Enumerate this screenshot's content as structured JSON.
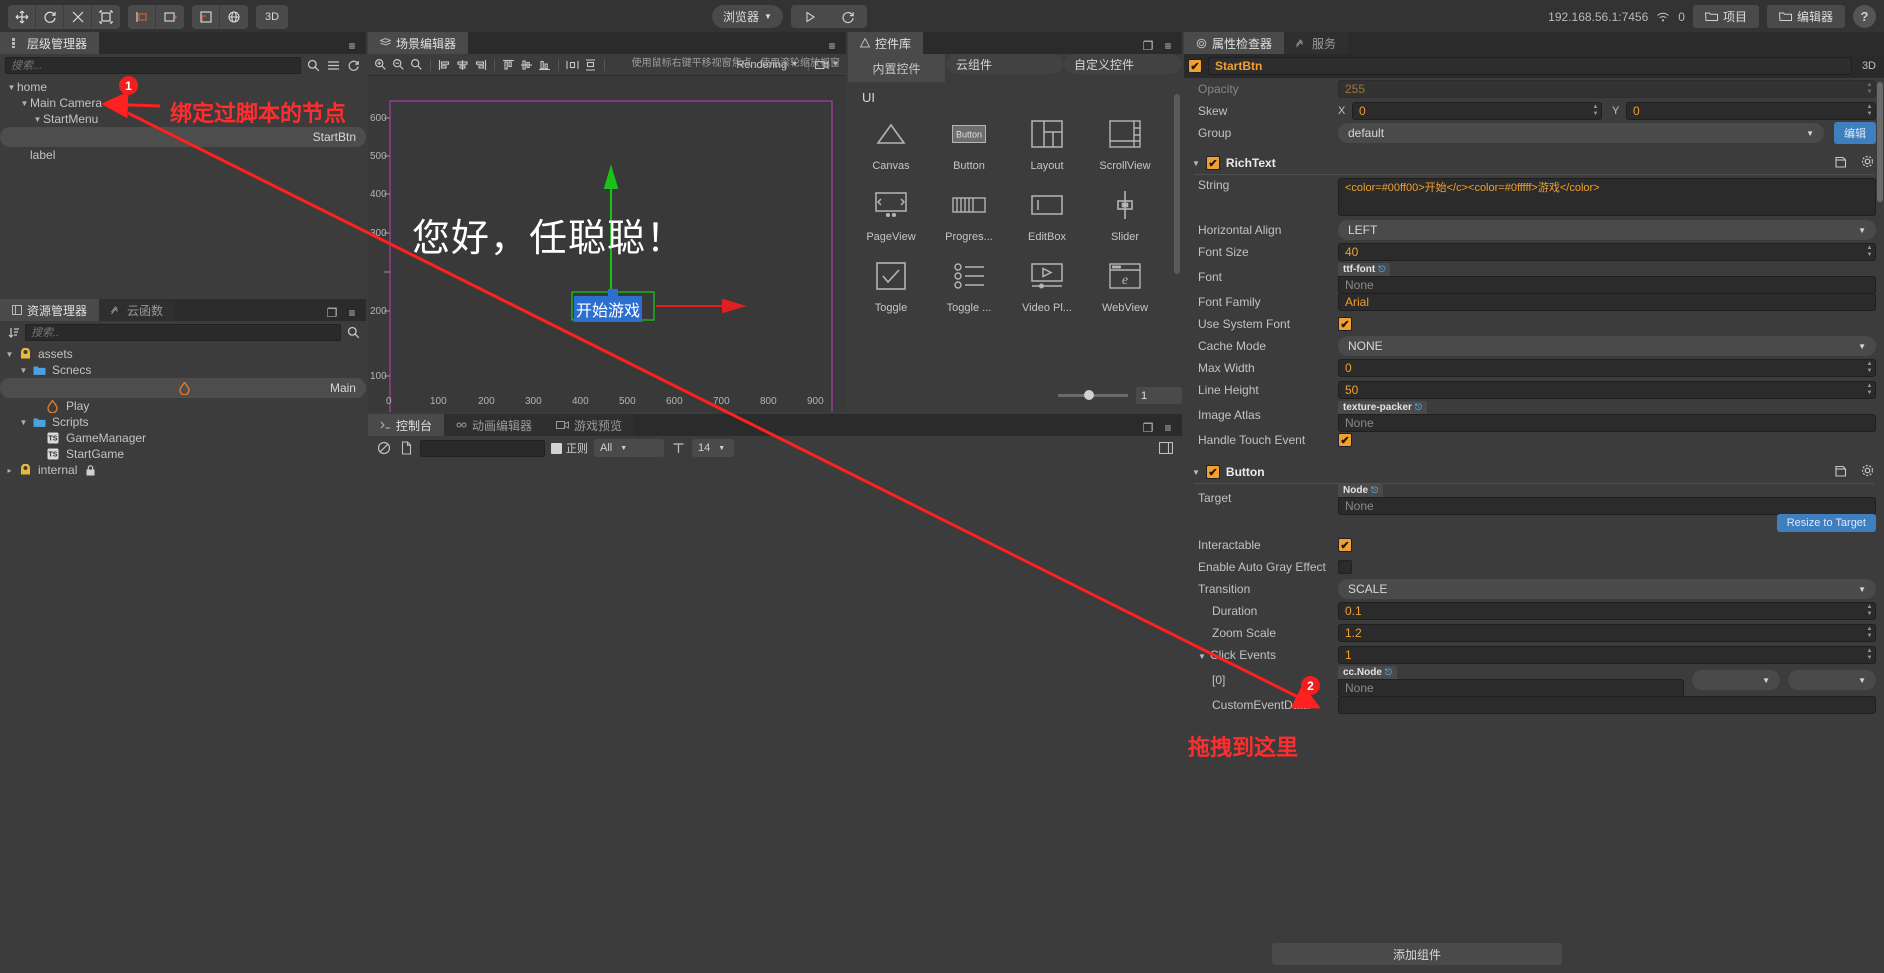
{
  "toolbar": {
    "tools": [
      "move-tool",
      "rotate-tool",
      "scale-tool",
      "rect-tool",
      "align-tool",
      "add-tool",
      "anchor-tool",
      "pivot-tool"
    ],
    "mode_3d": "3D",
    "preview_target": "浏览器",
    "play_label": "play-icon",
    "refresh_label": "refresh-icon"
  },
  "topright": {
    "ip": "192.168.56.1:7456",
    "wifi_count": "0",
    "project_btn": "项目",
    "editor_btn": "编辑器",
    "help_btn": "?"
  },
  "hierarchy": {
    "tab": "层级管理器",
    "search_placeholder": "搜索...",
    "nodes": [
      {
        "label": "home",
        "depth": 0,
        "expanded": true,
        "selected": false
      },
      {
        "label": "Main Camera",
        "depth": 1,
        "expanded": true,
        "selected": false
      },
      {
        "label": "StartMenu",
        "depth": 2,
        "expanded": true,
        "selected": false
      },
      {
        "label": "StartBtn",
        "depth": 3,
        "expanded": false,
        "selected": true
      },
      {
        "label": "label",
        "depth": 1,
        "expanded": false,
        "selected": false
      }
    ]
  },
  "assets": {
    "tabs": [
      "资源管理器",
      "云函数"
    ],
    "active_tab": "资源管理器",
    "search_placeholder": "搜索..",
    "items": [
      {
        "label": "assets",
        "depth": 0,
        "icon": "assets-icon",
        "expanded": true,
        "selected": false
      },
      {
        "label": "Scnecs",
        "depth": 1,
        "icon": "folder-icon",
        "expanded": true,
        "selected": false
      },
      {
        "label": "Main",
        "depth": 2,
        "icon": "scene-icon",
        "expanded": false,
        "selected": true
      },
      {
        "label": "Play",
        "depth": 2,
        "icon": "scene-icon",
        "expanded": false,
        "selected": false
      },
      {
        "label": "Scripts",
        "depth": 1,
        "icon": "folder-icon",
        "expanded": true,
        "selected": false
      },
      {
        "label": "GameManager",
        "depth": 2,
        "icon": "ts-icon",
        "expanded": false,
        "selected": false
      },
      {
        "label": "StartGame",
        "depth": 2,
        "icon": "ts-icon",
        "expanded": false,
        "selected": false
      },
      {
        "label": "internal",
        "depth": 0,
        "icon": "assets-icon",
        "expanded": false,
        "selected": false,
        "locked": true
      }
    ]
  },
  "scene": {
    "tab": "场景编辑器",
    "rendering_label": "Rendering",
    "hint": "使用鼠标右键平移视窗焦点 , 使用滚轮缩放视窗",
    "gizmo_zoom": "1",
    "canvas_text": "您好，任聪聪！",
    "button_text": "开始游戏",
    "y_ticks": [
      "600",
      "500",
      "400",
      "300",
      "200",
      "100",
      "0"
    ],
    "x_ticks": [
      "0",
      "100",
      "200",
      "300",
      "400",
      "500",
      "600",
      "700",
      "800",
      "900"
    ]
  },
  "console": {
    "tabs": [
      "控制台",
      "动画编辑器",
      "游戏预览"
    ],
    "active_tab": "控制台",
    "filter_value": "",
    "regex_label": "正则",
    "level": "All",
    "font_size": "14"
  },
  "widgets": {
    "tab": "控件库",
    "tabs": [
      "内置控件",
      "云组件",
      "自定义控件"
    ],
    "active_tab": "内置控件",
    "section": "UI",
    "items": [
      {
        "label": "Canvas",
        "icon": "canvas-icon"
      },
      {
        "label": "Button",
        "icon": "button-icon"
      },
      {
        "label": "Layout",
        "icon": "layout-icon"
      },
      {
        "label": "ScrollView",
        "icon": "scrollview-icon"
      },
      {
        "label": "PageView",
        "icon": "pageview-icon"
      },
      {
        "label": "Progres...",
        "icon": "progressbar-icon"
      },
      {
        "label": "EditBox",
        "icon": "editbox-icon"
      },
      {
        "label": "Slider",
        "icon": "slider-icon"
      },
      {
        "label": "Toggle",
        "icon": "toggle-icon"
      },
      {
        "label": "Toggle ...",
        "icon": "togglegroup-icon"
      },
      {
        "label": "Video Pl...",
        "icon": "videoplayer-icon"
      },
      {
        "label": "WebView",
        "icon": "webview-icon"
      }
    ]
  },
  "inspector": {
    "tabs": [
      "属性检查器",
      "服务"
    ],
    "active_tab": "属性检查器",
    "node_name": "StartBtn",
    "node_enabled": true,
    "mode_3d": "3D",
    "node_props": [
      {
        "label": "Opacity",
        "value": "255",
        "type": "number"
      },
      {
        "label": "Skew",
        "type": "xy",
        "x_label": "X",
        "x": "0",
        "y_label": "Y",
        "y": "0"
      },
      {
        "label": "Group",
        "type": "select",
        "value": "default",
        "button": "编辑"
      }
    ],
    "richtext": {
      "title": "RichText",
      "enabled": true,
      "props": [
        {
          "label": "String",
          "type": "textarea",
          "value": "<color=#00ff00>开始</c><color=#0fffff>游戏</color>"
        },
        {
          "label": "Horizontal Align",
          "type": "select",
          "value": "LEFT"
        },
        {
          "label": "Font Size",
          "type": "number",
          "value": "40"
        },
        {
          "label": "Font",
          "type": "asset",
          "tag": "ttf-font",
          "value": "None"
        },
        {
          "label": "Font Family",
          "type": "text",
          "value": "Arial"
        },
        {
          "label": "Use System Font",
          "type": "checkbox",
          "value": true
        },
        {
          "label": "Cache Mode",
          "type": "select",
          "value": "NONE"
        },
        {
          "label": "Max Width",
          "type": "number",
          "value": "0"
        },
        {
          "label": "Line Height",
          "type": "number",
          "value": "50"
        },
        {
          "label": "Image Atlas",
          "type": "asset",
          "tag": "texture-packer",
          "value": "None"
        },
        {
          "label": "Handle Touch Event",
          "type": "checkbox",
          "value": true
        }
      ]
    },
    "button": {
      "title": "Button",
      "enabled": true,
      "props": [
        {
          "label": "Target",
          "type": "asset",
          "tag": "Node",
          "value": "None"
        },
        {
          "label": "",
          "type": "button",
          "value": "Resize to Target"
        },
        {
          "label": "Interactable",
          "type": "checkbox",
          "value": true
        },
        {
          "label": "Enable Auto Gray Effect",
          "type": "checkbox",
          "value": false
        },
        {
          "label": "Transition",
          "type": "select",
          "value": "SCALE"
        },
        {
          "label": "Duration",
          "type": "number",
          "value": "0.1",
          "indent": true
        },
        {
          "label": "Zoom Scale",
          "type": "number",
          "value": "1.2",
          "indent": true
        },
        {
          "label": "Click Events",
          "type": "number",
          "value": "1",
          "group": true
        },
        {
          "label": "[0]",
          "type": "event",
          "tag": "cc.Node",
          "value": "None",
          "indent": true
        },
        {
          "label": "CustomEventData",
          "type": "text",
          "value": "",
          "indent": true
        }
      ]
    },
    "add_component": "添加组件"
  },
  "annotations": [
    {
      "id": "1",
      "text": "绑定过脚本的节点",
      "color": "#ff2d2d"
    },
    {
      "id": "2",
      "text": "拖拽到这里",
      "color": "#ff2d2d"
    }
  ]
}
